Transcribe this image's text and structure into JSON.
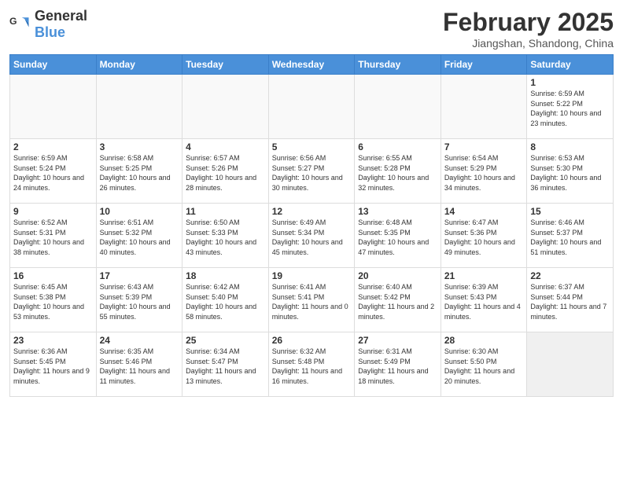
{
  "header": {
    "logo_general": "General",
    "logo_blue": "Blue",
    "title": "February 2025",
    "subtitle": "Jiangshan, Shandong, China"
  },
  "days_of_week": [
    "Sunday",
    "Monday",
    "Tuesday",
    "Wednesday",
    "Thursday",
    "Friday",
    "Saturday"
  ],
  "weeks": [
    [
      {
        "day": "",
        "info": ""
      },
      {
        "day": "",
        "info": ""
      },
      {
        "day": "",
        "info": ""
      },
      {
        "day": "",
        "info": ""
      },
      {
        "day": "",
        "info": ""
      },
      {
        "day": "",
        "info": ""
      },
      {
        "day": "1",
        "info": "Sunrise: 6:59 AM\nSunset: 5:22 PM\nDaylight: 10 hours and 23 minutes."
      }
    ],
    [
      {
        "day": "2",
        "info": "Sunrise: 6:59 AM\nSunset: 5:24 PM\nDaylight: 10 hours and 24 minutes."
      },
      {
        "day": "3",
        "info": "Sunrise: 6:58 AM\nSunset: 5:25 PM\nDaylight: 10 hours and 26 minutes."
      },
      {
        "day": "4",
        "info": "Sunrise: 6:57 AM\nSunset: 5:26 PM\nDaylight: 10 hours and 28 minutes."
      },
      {
        "day": "5",
        "info": "Sunrise: 6:56 AM\nSunset: 5:27 PM\nDaylight: 10 hours and 30 minutes."
      },
      {
        "day": "6",
        "info": "Sunrise: 6:55 AM\nSunset: 5:28 PM\nDaylight: 10 hours and 32 minutes."
      },
      {
        "day": "7",
        "info": "Sunrise: 6:54 AM\nSunset: 5:29 PM\nDaylight: 10 hours and 34 minutes."
      },
      {
        "day": "8",
        "info": "Sunrise: 6:53 AM\nSunset: 5:30 PM\nDaylight: 10 hours and 36 minutes."
      }
    ],
    [
      {
        "day": "9",
        "info": "Sunrise: 6:52 AM\nSunset: 5:31 PM\nDaylight: 10 hours and 38 minutes."
      },
      {
        "day": "10",
        "info": "Sunrise: 6:51 AM\nSunset: 5:32 PM\nDaylight: 10 hours and 40 minutes."
      },
      {
        "day": "11",
        "info": "Sunrise: 6:50 AM\nSunset: 5:33 PM\nDaylight: 10 hours and 43 minutes."
      },
      {
        "day": "12",
        "info": "Sunrise: 6:49 AM\nSunset: 5:34 PM\nDaylight: 10 hours and 45 minutes."
      },
      {
        "day": "13",
        "info": "Sunrise: 6:48 AM\nSunset: 5:35 PM\nDaylight: 10 hours and 47 minutes."
      },
      {
        "day": "14",
        "info": "Sunrise: 6:47 AM\nSunset: 5:36 PM\nDaylight: 10 hours and 49 minutes."
      },
      {
        "day": "15",
        "info": "Sunrise: 6:46 AM\nSunset: 5:37 PM\nDaylight: 10 hours and 51 minutes."
      }
    ],
    [
      {
        "day": "16",
        "info": "Sunrise: 6:45 AM\nSunset: 5:38 PM\nDaylight: 10 hours and 53 minutes."
      },
      {
        "day": "17",
        "info": "Sunrise: 6:43 AM\nSunset: 5:39 PM\nDaylight: 10 hours and 55 minutes."
      },
      {
        "day": "18",
        "info": "Sunrise: 6:42 AM\nSunset: 5:40 PM\nDaylight: 10 hours and 58 minutes."
      },
      {
        "day": "19",
        "info": "Sunrise: 6:41 AM\nSunset: 5:41 PM\nDaylight: 11 hours and 0 minutes."
      },
      {
        "day": "20",
        "info": "Sunrise: 6:40 AM\nSunset: 5:42 PM\nDaylight: 11 hours and 2 minutes."
      },
      {
        "day": "21",
        "info": "Sunrise: 6:39 AM\nSunset: 5:43 PM\nDaylight: 11 hours and 4 minutes."
      },
      {
        "day": "22",
        "info": "Sunrise: 6:37 AM\nSunset: 5:44 PM\nDaylight: 11 hours and 7 minutes."
      }
    ],
    [
      {
        "day": "23",
        "info": "Sunrise: 6:36 AM\nSunset: 5:45 PM\nDaylight: 11 hours and 9 minutes."
      },
      {
        "day": "24",
        "info": "Sunrise: 6:35 AM\nSunset: 5:46 PM\nDaylight: 11 hours and 11 minutes."
      },
      {
        "day": "25",
        "info": "Sunrise: 6:34 AM\nSunset: 5:47 PM\nDaylight: 11 hours and 13 minutes."
      },
      {
        "day": "26",
        "info": "Sunrise: 6:32 AM\nSunset: 5:48 PM\nDaylight: 11 hours and 16 minutes."
      },
      {
        "day": "27",
        "info": "Sunrise: 6:31 AM\nSunset: 5:49 PM\nDaylight: 11 hours and 18 minutes."
      },
      {
        "day": "28",
        "info": "Sunrise: 6:30 AM\nSunset: 5:50 PM\nDaylight: 11 hours and 20 minutes."
      },
      {
        "day": "",
        "info": ""
      }
    ]
  ]
}
